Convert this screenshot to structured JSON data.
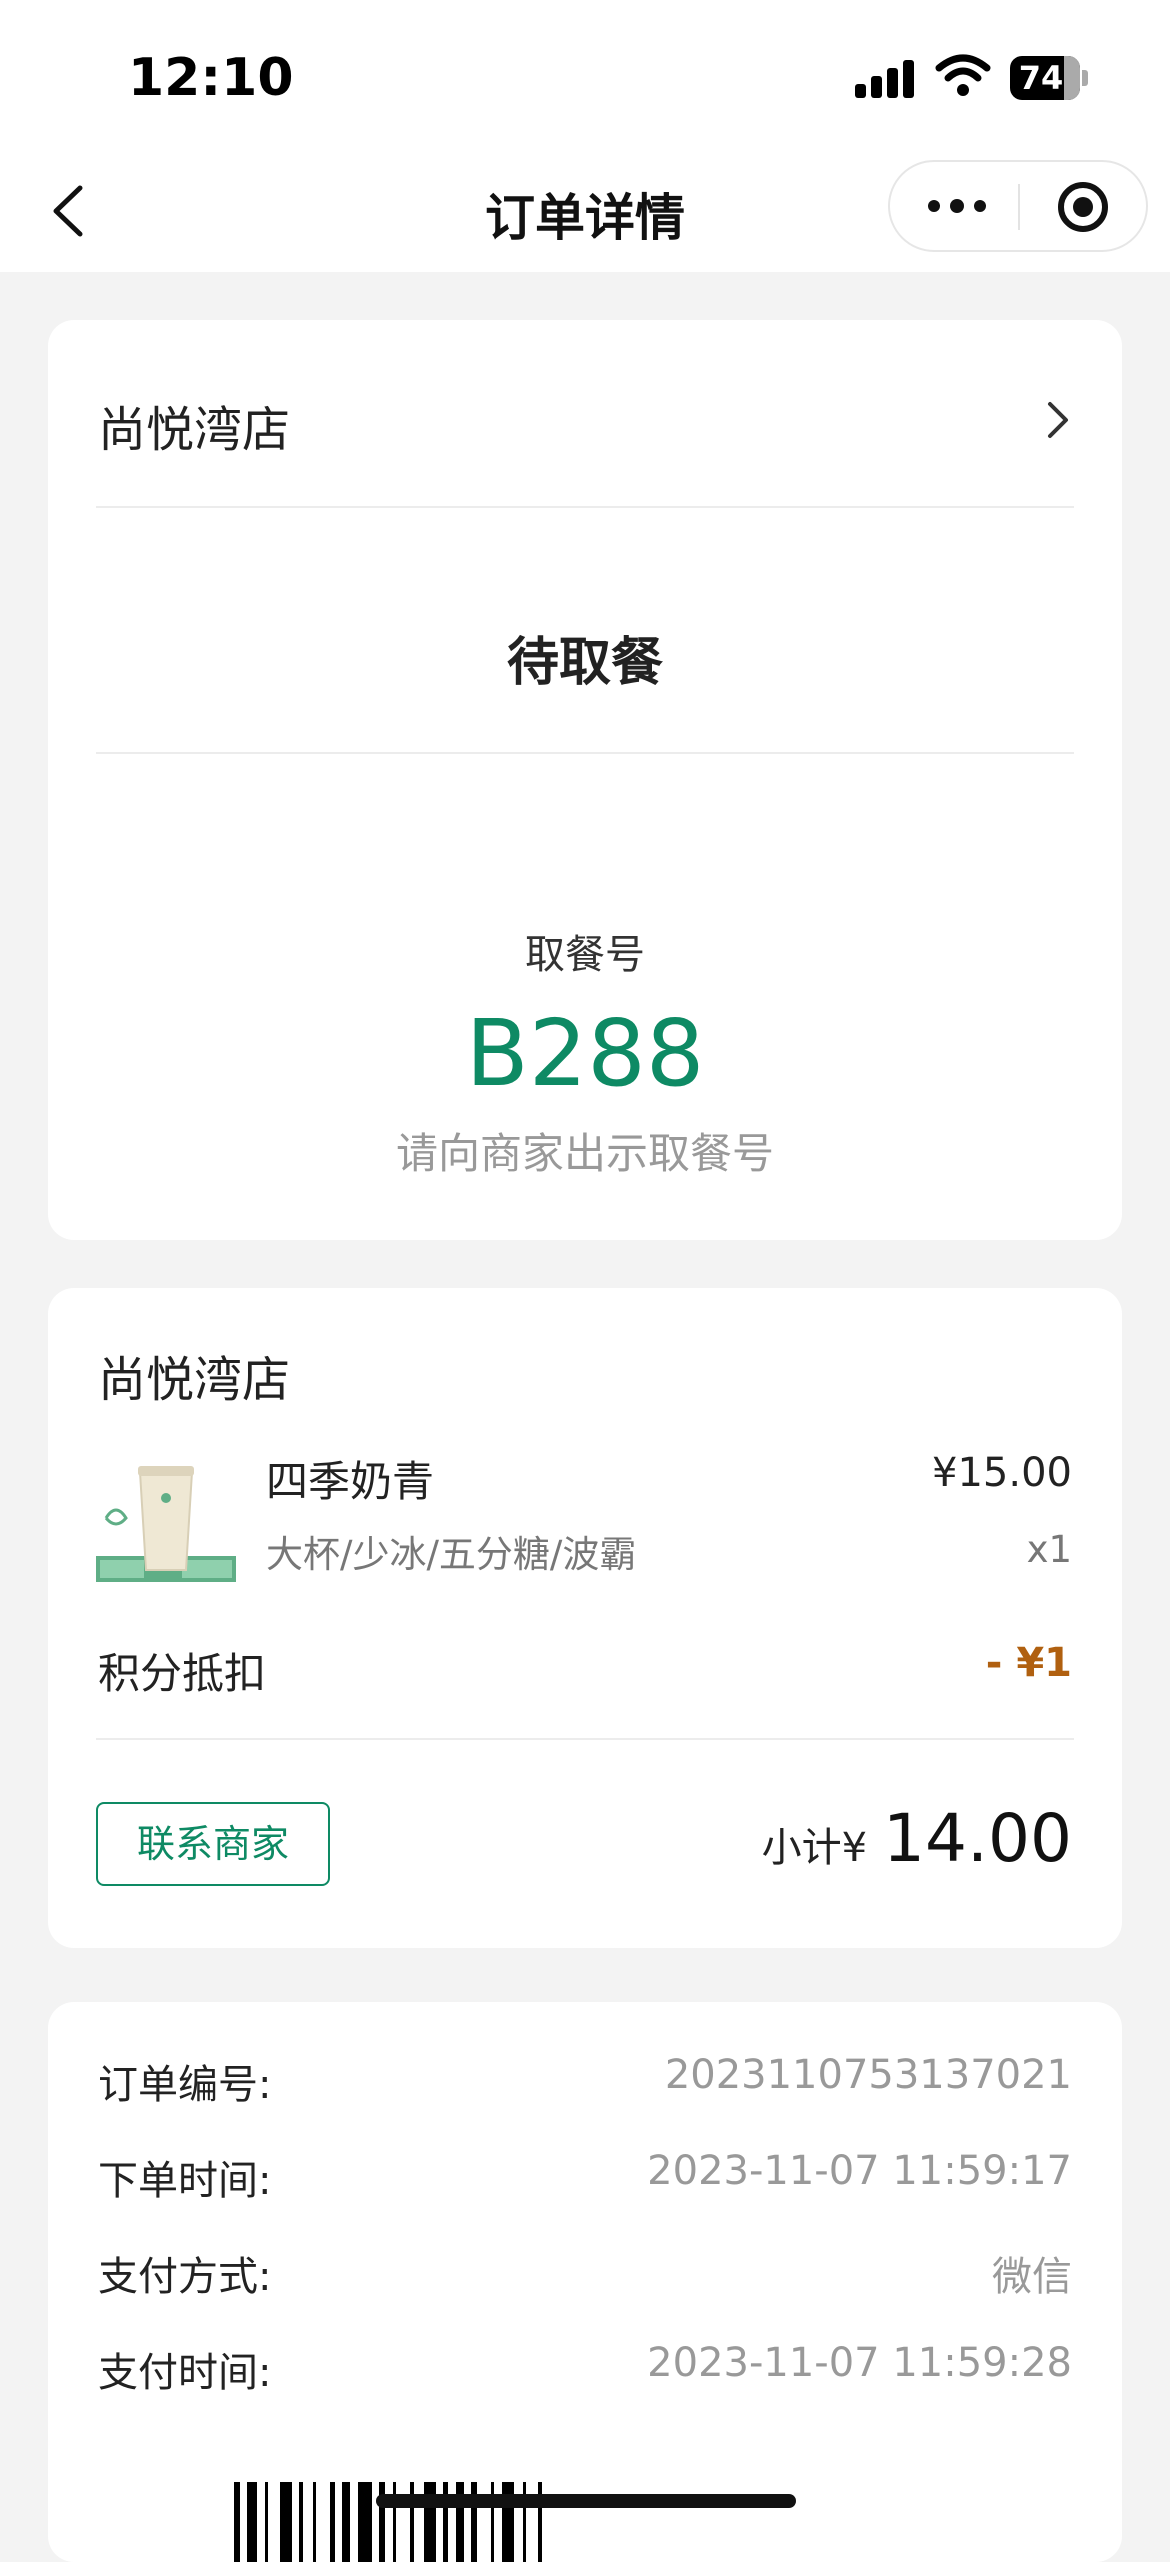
{
  "status_bar": {
    "time": "12:10",
    "battery": "74"
  },
  "nav": {
    "title": "订单详情"
  },
  "order_status": {
    "store_name": "尚悦湾店",
    "status": "待取餐",
    "pickup_label": "取餐号",
    "pickup_number": "B288",
    "pickup_hint": "请向商家出示取餐号"
  },
  "items_card": {
    "store_name": "尚悦湾店",
    "items": [
      {
        "name": "四季奶青",
        "spec": "大杯/少冰/五分糖/波霸",
        "price": "¥15.00",
        "qty": "x1"
      }
    ],
    "points_label": "积分抵扣",
    "points_value": "- ¥1",
    "contact_button": "联系商家",
    "subtotal_label": "小计",
    "subtotal_currency": "¥",
    "subtotal_amount": "14.00"
  },
  "order_info": [
    {
      "key": "订单编号:",
      "value": "2023110753137021"
    },
    {
      "key": "下单时间:",
      "value": "2023-11-07 11:59:17"
    },
    {
      "key": "支付方式:",
      "value": "微信"
    },
    {
      "key": "支付时间:",
      "value": "2023-11-07 11:59:28"
    }
  ],
  "colors": {
    "accent": "#0e8a64",
    "discount": "#b06010",
    "background": "#f3f3f3"
  }
}
